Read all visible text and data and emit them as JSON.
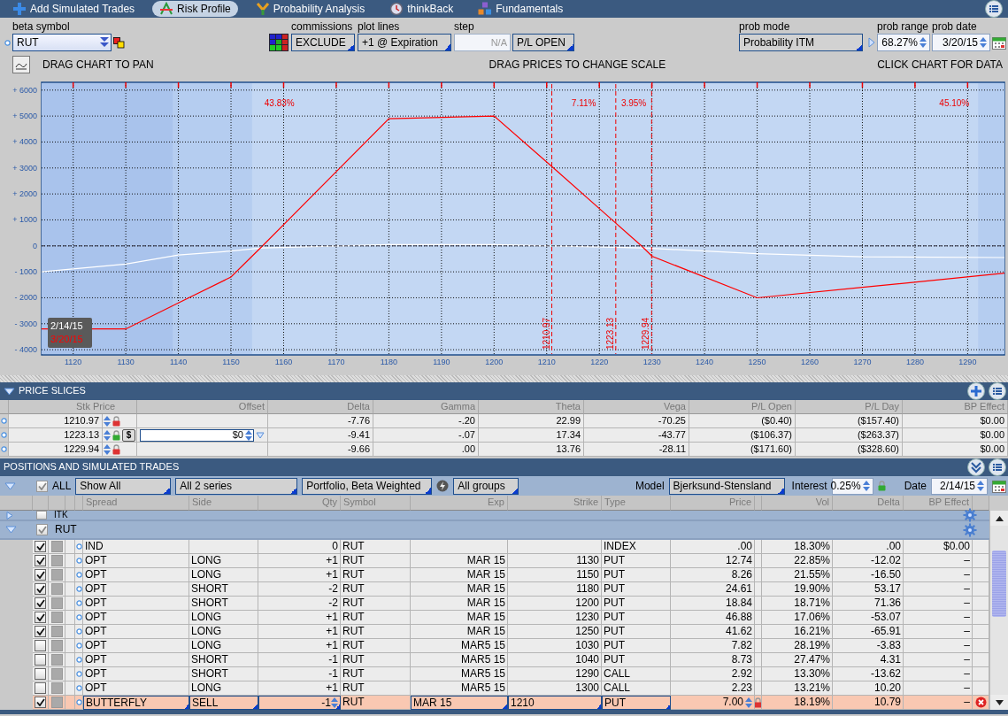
{
  "tabs": [
    {
      "label": "Add Simulated Trades",
      "selected": false
    },
    {
      "label": "Risk Profile",
      "selected": true
    },
    {
      "label": "Probability Analysis",
      "selected": false
    },
    {
      "label": "thinkBack",
      "selected": false
    },
    {
      "label": "Fundamentals",
      "selected": false
    }
  ],
  "controls": {
    "beta_symbol": {
      "label": "beta symbol",
      "value": "RUT"
    },
    "commissions": {
      "label": "commissions",
      "value": "EXCLUDE"
    },
    "plot_lines": {
      "label": "plot lines",
      "value": "+1 @ Expiration"
    },
    "step": {
      "label": "step",
      "placeholder": "N/A"
    },
    "pl_mode": {
      "value": "P/L OPEN"
    },
    "prob_mode": {
      "label": "prob mode",
      "value": "Probability ITM"
    },
    "prob_range": {
      "label": "prob range",
      "value": "68.27%"
    },
    "prob_date": {
      "label": "prob date",
      "value": "3/20/15"
    }
  },
  "chart_hints": [
    "DRAG CHART TO PAN",
    "DRAG PRICES TO CHANGE SCALE",
    "CLICK CHART FOR DATA"
  ],
  "chart_data": {
    "type": "line",
    "xlim": [
      1114,
      1297
    ],
    "ylim": [
      -4200,
      6300
    ],
    "xticks": [
      1120,
      1130,
      1140,
      1150,
      1160,
      1170,
      1180,
      1190,
      1200,
      1210,
      1220,
      1230,
      1240,
      1250,
      1260,
      1270,
      1280,
      1290
    ],
    "yticks": [
      {
        "value": 6000,
        "label": "+ 6000"
      },
      {
        "value": 5000,
        "label": "+ 5000"
      },
      {
        "value": 4000,
        "label": "+ 4000"
      },
      {
        "value": 3000,
        "label": "+ 3000"
      },
      {
        "value": 2000,
        "label": "+ 2000"
      },
      {
        "value": 1000,
        "label": "+ 1000"
      },
      {
        "value": 0,
        "label": "0"
      },
      {
        "value": -1000,
        "label": "- 1000"
      },
      {
        "value": -2000,
        "label": "- 2000"
      },
      {
        "value": -3000,
        "label": "- 3000"
      },
      {
        "value": -4000,
        "label": "- 4000"
      }
    ],
    "x": [
      1114,
      1130,
      1140,
      1150,
      1156,
      1180,
      1200,
      1211,
      1223,
      1228,
      1230,
      1250,
      1270,
      1297
    ],
    "series": [
      {
        "name": "2/14/15",
        "color": "#ffffff",
        "values": [
          -1000,
          -700,
          -350,
          -200,
          -80,
          50,
          50,
          0,
          -50,
          -80,
          -100,
          -300,
          -420,
          -450
        ]
      },
      {
        "name": "3/20/15",
        "color": "#ff0000",
        "values": [
          -3200,
          -3200,
          -2200,
          -1200,
          0,
          4900,
          5000,
          3050,
          900,
          0,
          -400,
          -2000,
          -1600,
          -1050
        ]
      }
    ],
    "grid": true,
    "bands": [
      {
        "axis": "x",
        "from": 1114,
        "to": 1139,
        "color": "#a9c3ec"
      },
      {
        "axis": "x",
        "from": 1139,
        "to": 1154,
        "color": "#b5cdf0"
      },
      {
        "axis": "x",
        "from": 1292,
        "to": 1297,
        "color": "#b5cdf0"
      }
    ],
    "ref_lines": [
      {
        "axis": "y",
        "value": 0
      },
      {
        "axis": "x",
        "value": 1210.97,
        "label": "1210.97"
      },
      {
        "axis": "x",
        "value": 1223.13,
        "label": "1223.13"
      },
      {
        "axis": "x",
        "value": 1229.94,
        "label": "1229.94"
      }
    ],
    "annotations": [
      "43.83%",
      "7.11%",
      "3.95%",
      "45.10%"
    ]
  },
  "price_slices": {
    "title": "PRICE SLICES",
    "columns": [
      "Stk Price",
      "Offset",
      "Delta",
      "Gamma",
      "Theta",
      "Vega",
      "P/L Open",
      "P/L Day",
      "BP Effect"
    ],
    "rows": [
      {
        "price": "1210.97",
        "locked": true,
        "delta": "-7.76",
        "gamma": "-.20",
        "theta": "22.99",
        "vega": "-70.25",
        "pl_open": "($0.40)",
        "pl_day": "($157.40)",
        "bp": "$0.00"
      },
      {
        "price": "1223.13",
        "locked": false,
        "button": "$",
        "offset": "$0",
        "delta": "-9.41",
        "gamma": "-.07",
        "theta": "17.34",
        "vega": "-43.77",
        "pl_open": "($106.37)",
        "pl_day": "($263.37)",
        "bp": "$0.00"
      },
      {
        "price": "1229.94",
        "locked": true,
        "delta": "-9.66",
        "gamma": ".00",
        "theta": "13.76",
        "vega": "-28.11",
        "pl_open": "($171.60)",
        "pl_day": "($328.60)",
        "bp": "$0.00"
      }
    ]
  },
  "positions": {
    "title": "POSITIONS AND SIMULATED TRADES",
    "filter": {
      "all_label": "ALL",
      "all_checked": true,
      "show": "Show All",
      "series": "All 2 series",
      "mode": "Portfolio, Beta Weighted",
      "groups": "All groups",
      "model_label": "Model",
      "model": "Bjerksund-Stensland",
      "interest_label": "Interest",
      "interest": "0.25%",
      "date_label": "Date",
      "date": "2/14/15"
    },
    "columns": [
      "Spread",
      "Side",
      "Qty",
      "Symbol",
      "Exp",
      "Strike",
      "Type",
      "Price",
      "Vol",
      "Delta",
      "BP Effect"
    ],
    "groups": [
      {
        "symbol": "ITK",
        "expanded": false,
        "checked": false
      },
      {
        "symbol": "RUT",
        "expanded": true,
        "checked": true,
        "rows": [
          {
            "kind": "position",
            "checked": true,
            "spread": "IND",
            "qty": "0",
            "symbol": "RUT",
            "type": "INDEX",
            "price": ".00",
            "vol": "18.30%",
            "delta": ".00",
            "bp": "$0.00"
          },
          {
            "kind": "position",
            "checked": true,
            "spread": "OPT",
            "side": "LONG",
            "qty": "+1",
            "symbol": "RUT",
            "exp": "MAR 15",
            "strike": "1130",
            "type": "PUT",
            "price": "12.74",
            "vol": "22.85%",
            "delta": "-12.02",
            "bp": "–"
          },
          {
            "kind": "position",
            "checked": true,
            "spread": "OPT",
            "side": "LONG",
            "qty": "+1",
            "symbol": "RUT",
            "exp": "MAR 15",
            "strike": "1150",
            "type": "PUT",
            "price": "8.26",
            "vol": "21.55%",
            "delta": "-16.50",
            "bp": "–"
          },
          {
            "kind": "position",
            "checked": true,
            "spread": "OPT",
            "side": "SHORT",
            "qty": "-2",
            "symbol": "RUT",
            "exp": "MAR 15",
            "strike": "1180",
            "type": "PUT",
            "price": "24.61",
            "vol": "19.90%",
            "delta": "53.17",
            "bp": "–"
          },
          {
            "kind": "position",
            "checked": true,
            "spread": "OPT",
            "side": "SHORT",
            "qty": "-2",
            "symbol": "RUT",
            "exp": "MAR 15",
            "strike": "1200",
            "type": "PUT",
            "price": "18.84",
            "vol": "18.71%",
            "delta": "71.36",
            "bp": "–"
          },
          {
            "kind": "position",
            "checked": true,
            "spread": "OPT",
            "side": "LONG",
            "qty": "+1",
            "symbol": "RUT",
            "exp": "MAR 15",
            "strike": "1230",
            "type": "PUT",
            "price": "46.88",
            "vol": "17.06%",
            "delta": "-53.07",
            "bp": "–"
          },
          {
            "kind": "position",
            "checked": true,
            "spread": "OPT",
            "side": "LONG",
            "qty": "+1",
            "symbol": "RUT",
            "exp": "MAR 15",
            "strike": "1250",
            "type": "PUT",
            "price": "41.62",
            "vol": "16.21%",
            "delta": "-65.91",
            "bp": "–"
          },
          {
            "kind": "position",
            "checked": false,
            "spread": "OPT",
            "side": "LONG",
            "qty": "+1",
            "symbol": "RUT",
            "exp": "MAR5 15",
            "strike": "1030",
            "type": "PUT",
            "price": "7.82",
            "vol": "28.19%",
            "delta": "-3.83",
            "bp": "–"
          },
          {
            "kind": "position",
            "checked": false,
            "spread": "OPT",
            "side": "SHORT",
            "qty": "-1",
            "symbol": "RUT",
            "exp": "MAR5 15",
            "strike": "1040",
            "type": "PUT",
            "price": "8.73",
            "vol": "27.47%",
            "delta": "4.31",
            "bp": "–"
          },
          {
            "kind": "position",
            "checked": false,
            "spread": "OPT",
            "side": "SHORT",
            "qty": "-1",
            "symbol": "RUT",
            "exp": "MAR5 15",
            "strike": "1290",
            "type": "CALL",
            "price": "2.92",
            "vol": "13.30%",
            "delta": "-13.62",
            "bp": "–"
          },
          {
            "kind": "position",
            "checked": false,
            "spread": "OPT",
            "side": "LONG",
            "qty": "+1",
            "symbol": "RUT",
            "exp": "MAR5 15",
            "strike": "1300",
            "type": "CALL",
            "price": "2.23",
            "vol": "13.21%",
            "delta": "10.20",
            "bp": "–"
          },
          {
            "kind": "simulated",
            "checked": true,
            "spread": "BUTTERFLY",
            "side": "SELL",
            "qty": "-1",
            "symbol": "RUT",
            "exp": "MAR 15",
            "strike": "1210",
            "type": "PUT",
            "price": "7.00",
            "vol": "18.19%",
            "delta": "10.79",
            "bp": "–"
          }
        ]
      }
    ]
  }
}
